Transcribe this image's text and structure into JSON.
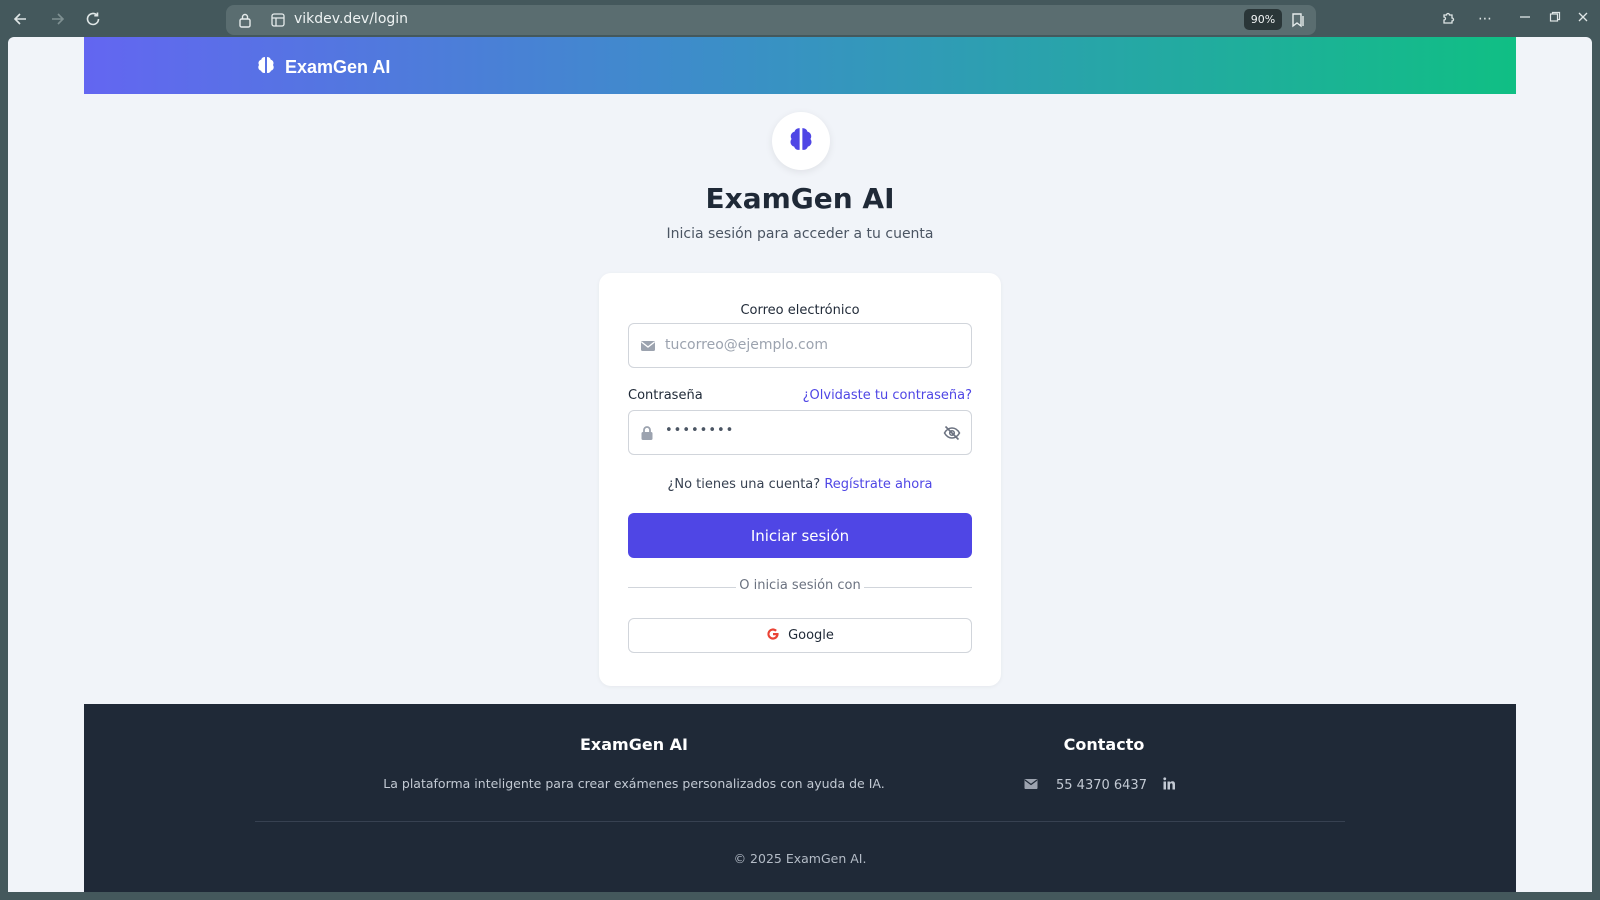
{
  "browser": {
    "url": "vikdev.dev/login",
    "zoom": "90%"
  },
  "header": {
    "brand": "ExamGen AI"
  },
  "hero": {
    "title": "ExamGen AI",
    "subtitle": "Inicia sesión para acceder a tu cuenta"
  },
  "login": {
    "email_label": "Correo electrónico",
    "email_placeholder": "tucorreo@ejemplo.com",
    "password_label": "Contraseña",
    "forgot_link": "¿Olvidaste tu contraseña?",
    "password_value": "••••••••",
    "no_account_text": "¿No tienes una cuenta?",
    "register_link": "Regístrate ahora",
    "submit_label": "Iniciar sesión",
    "divider_text": "O inicia sesión con",
    "google_label": "Google"
  },
  "footer": {
    "brand_title": "ExamGen AI",
    "description": "La plataforma inteligente para crear exámenes personalizados con ayuda de IA.",
    "contact_title": "Contacto",
    "phone": "55 4370 6437",
    "copyright": "© 2025 ExamGen AI."
  },
  "colors": {
    "accent": "#4f46e5",
    "header_gradient_start": "#6366f1",
    "header_gradient_end": "#10bf84",
    "footer_bg": "#1f2937"
  },
  "icons": [
    "back-arrow-icon",
    "forward-arrow-icon",
    "reload-icon",
    "lock-icon",
    "site-settings-icon",
    "reading-mode-icon",
    "extensions-icon",
    "more-icon",
    "brain-icon",
    "envelope-icon",
    "padlock-icon",
    "eye-slash-icon",
    "google-icon",
    "linkedin-icon"
  ]
}
